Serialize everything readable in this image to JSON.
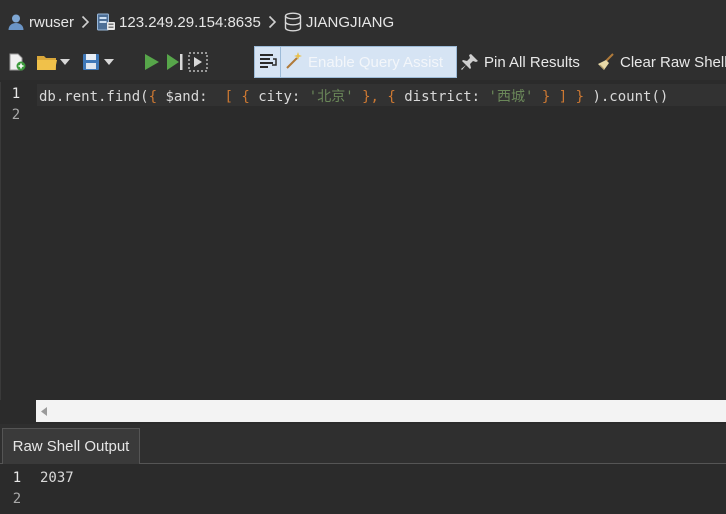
{
  "breadcrumb": {
    "user": "rwuser",
    "host": "123.249.29.154:8635",
    "database": "JIANGJIANG"
  },
  "toolbar": {
    "query_assist_label": "Enable Query Assist",
    "pin_label": "Pin All Results",
    "clear_label": "Clear Raw Shell"
  },
  "editor": {
    "line_numbers": [
      "1",
      "2"
    ],
    "code": {
      "t1": "db.rent.find(",
      "t2": "{",
      "t3": " $and:  ",
      "t4": "[",
      "t5": " ",
      "t6": "{",
      "t7": " city: ",
      "t8": "'北京'",
      "t9": " ",
      "t10": "}",
      "t11": ", ",
      "t12": "{",
      "t13": " district: ",
      "t14": "'西城'",
      "t15": " ",
      "t16": "}",
      "t17": " ",
      "t18": "]",
      "t19": " ",
      "t20": "}",
      "t21": " ).count()"
    }
  },
  "output_panel": {
    "tab_label": "Raw Shell Output",
    "line_numbers": [
      "1",
      "2"
    ],
    "result": "2037"
  },
  "colors": {
    "bracket": "#cc7832",
    "string": "#6a8759",
    "query_assist_bg": "#d6e4f4"
  }
}
